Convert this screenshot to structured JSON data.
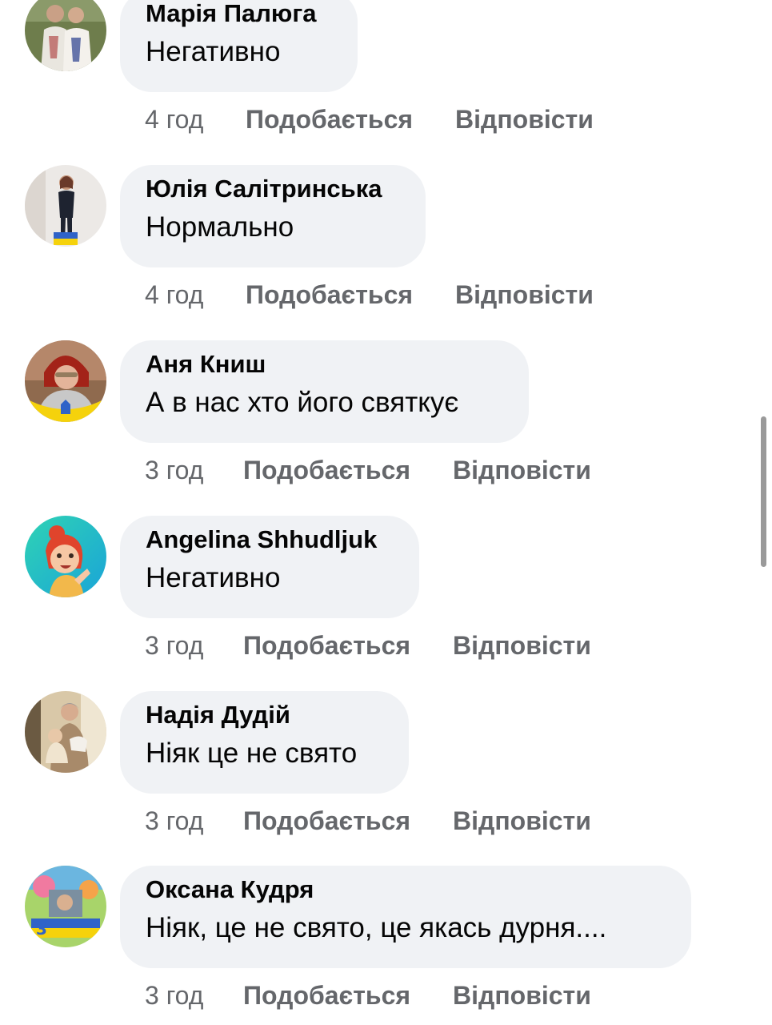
{
  "comments": [
    {
      "author": "Марія Палюга",
      "text": "Негативно",
      "time": "4 год",
      "like": "Подобається",
      "reply": "Відповісти",
      "avatar": "avatar-couple-embroidered"
    },
    {
      "author": "Юлія Салітринська",
      "text": "Нормально",
      "time": "4 год",
      "like": "Подобається",
      "reply": "Відповісти",
      "avatar": "avatar-woman-standing-flag"
    },
    {
      "author": "Аня Книш",
      "text": "А в нас хто його святкує",
      "time": "3 год",
      "like": "Подобається",
      "reply": "Відповісти",
      "avatar": "avatar-woman-ukraine-frame"
    },
    {
      "author": "Angelina Shhudljuk",
      "text": "Негативно",
      "time": "3 год",
      "like": "Подобається",
      "reply": "Відповісти",
      "avatar": "avatar-cartoon-girl"
    },
    {
      "author": "Надія Дудій",
      "text": "Ніяк це не свято",
      "time": "3 год",
      "like": "Подобається",
      "reply": "Відповісти",
      "avatar": "avatar-woman-child"
    },
    {
      "author": "Оксана Кудря",
      "text": "Ніяк, це не свято, це якась дурня....",
      "time": "3 год",
      "like": "Подобається",
      "reply": "Відповісти",
      "avatar": "avatar-collage"
    }
  ],
  "colors": {
    "bubble": "#f0f2f5",
    "meta": "#65676b",
    "text": "#050505"
  }
}
